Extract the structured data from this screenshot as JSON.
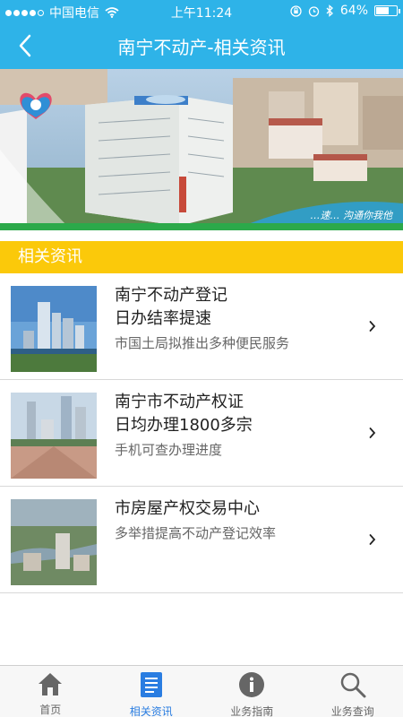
{
  "status": {
    "carrier": "中国电信",
    "time": "上午11:24",
    "battery": "64%",
    "battery_level": 0.64
  },
  "nav": {
    "title": "南宁不动产-相关资讯",
    "back_icon": "chevron-left-icon"
  },
  "banner": {
    "caption": "…速… 沟通你我他"
  },
  "section": {
    "title": "相关资讯"
  },
  "news": [
    {
      "title_lines": [
        "南宁不动产登记",
        "日办结率提速"
      ],
      "subtitle": "市国土局拟推出多种便民服务"
    },
    {
      "title_lines": [
        "南宁市不动产权证",
        "日均办理1800多宗"
      ],
      "subtitle": "手机可查办理进度"
    },
    {
      "title_lines": [
        "市房屋产权交易中心"
      ],
      "subtitle": "多举措提高不动产登记效率"
    }
  ],
  "tabs": [
    {
      "label": "首页",
      "icon": "home-icon",
      "active": false
    },
    {
      "label": "相关资讯",
      "icon": "news-list-icon",
      "active": true
    },
    {
      "label": "业务指南",
      "icon": "info-icon",
      "active": false
    },
    {
      "label": "业务查询",
      "icon": "search-icon",
      "active": false
    }
  ],
  "colors": {
    "primary": "#2eb3e8",
    "section": "#fbc90a",
    "active_tab": "#2a7de1"
  }
}
